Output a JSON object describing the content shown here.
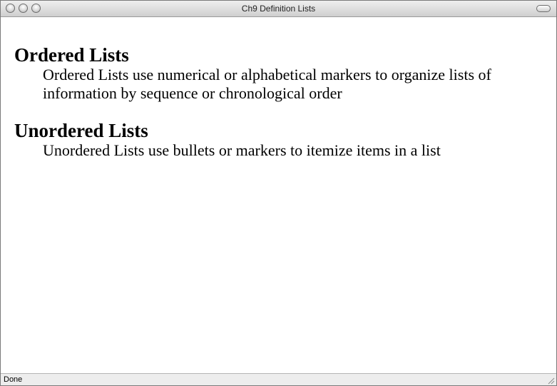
{
  "window": {
    "title": "Ch9 Definition Lists"
  },
  "content": {
    "definitions": [
      {
        "term": "Ordered Lists",
        "description": "Ordered Lists use numerical or alphabetical markers to organize lists of information by sequence or chronological order"
      },
      {
        "term": "Unordered Lists",
        "description": "Unordered Lists use bullets or markers to itemize items in a list"
      }
    ]
  },
  "statusbar": {
    "text": "Done"
  }
}
